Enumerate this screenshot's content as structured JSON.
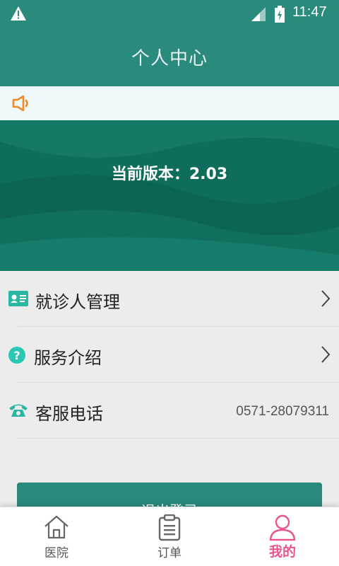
{
  "status_bar": {
    "time": "11:47"
  },
  "header": {
    "title": "个人中心"
  },
  "banner": {
    "version_text": "当前版本：2.03"
  },
  "menu": {
    "items": [
      {
        "label": "就诊人管理",
        "icon": "id-card-icon"
      },
      {
        "label": "服务介绍",
        "icon": "help-circle-icon"
      },
      {
        "label": "客服电话",
        "icon": "phone-icon",
        "value": "0571-28079311"
      }
    ]
  },
  "logout": {
    "label": "退出登录"
  },
  "tabs": [
    {
      "label": "医院",
      "icon": "home-icon"
    },
    {
      "label": "订单",
      "icon": "clipboard-icon"
    },
    {
      "label": "我的",
      "icon": "user-icon",
      "active": true
    }
  ],
  "colors": {
    "primary": "#2a8a7c",
    "accent": "#e8548f",
    "banner": "#0f6e5b",
    "notice_icon": "#f08a24"
  }
}
